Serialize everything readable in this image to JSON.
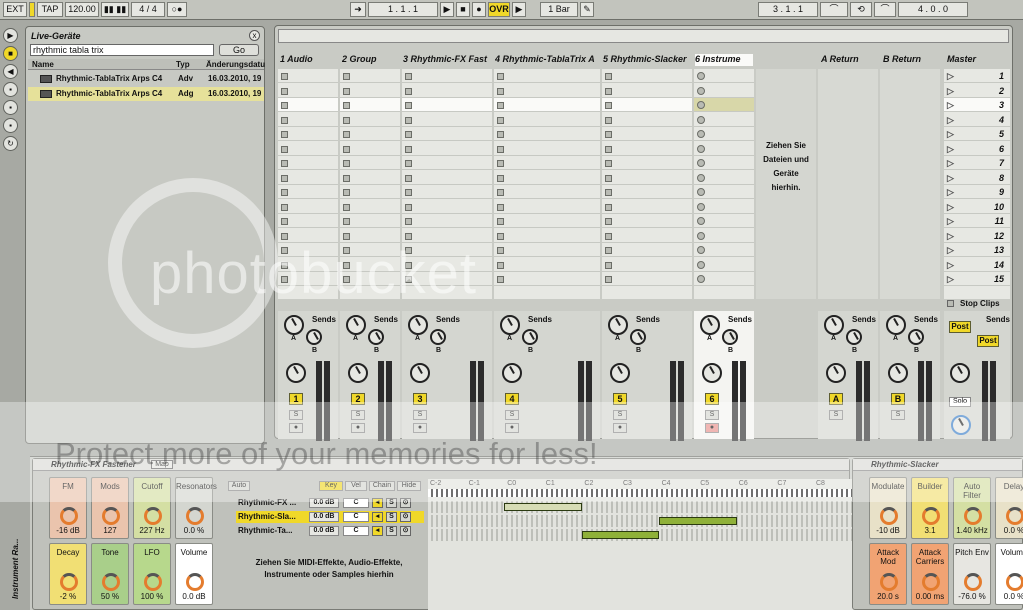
{
  "transport": {
    "ext": "EXT",
    "tap": "TAP",
    "tempo": "120.00",
    "signature": "4 / 4",
    "position": "1 .   1 .   1",
    "ovr": "OVR",
    "quantize": "1 Bar",
    "loop_start": "3 .   1 .   1",
    "loop_length": "4 .   0 .   0"
  },
  "browser": {
    "title": "Live-Geräte",
    "close": "x",
    "search": "rhythmic tabla trix",
    "go": "Go",
    "columns": [
      "Name",
      "Typ",
      "Änderungsdatu"
    ],
    "rows": [
      {
        "name": "Rhythmic-TablaTrix Arps C4",
        "type": "Adv",
        "date": "16.03.2010, 19:"
      },
      {
        "name": "Rhythmic-TablaTrix Arps C4",
        "type": "Adg",
        "date": "16.03.2010, 19:"
      }
    ]
  },
  "session": {
    "tracks": [
      "1 Audio",
      "2 Group",
      "3 Rhythmic-FX Fast",
      "4 Rhythmic-TablaTrix A",
      "5 Rhythmic-Slacker",
      "6 Instrume"
    ],
    "returns": [
      "A Return",
      "B Return"
    ],
    "master": "Master",
    "scenes": [
      "1",
      "2",
      "3",
      "4",
      "5",
      "6",
      "7",
      "8",
      "9",
      "10",
      "11",
      "12",
      "13",
      "14",
      "15"
    ],
    "drop_hint": "Ziehen Sie Dateien und Geräte hierhin.",
    "stop_clips": "Stop Clips",
    "sends_label": "Sends",
    "send_a": "A",
    "send_b": "B",
    "post": "Post",
    "solo": "Solo",
    "track_numbers": [
      "1",
      "2",
      "3",
      "4",
      "5",
      "6"
    ],
    "return_letters": [
      "A",
      "B"
    ],
    "s": "S"
  },
  "detail": {
    "device1": {
      "title": "Rhythmic-FX Fastener",
      "map": "Map",
      "macros_top": [
        {
          "label": "FM",
          "value": "-16 dB"
        },
        {
          "label": "Mods",
          "value": "127"
        },
        {
          "label": "Cutoff",
          "value": "227 Hz"
        },
        {
          "label": "Resonators",
          "value": "0.0 %"
        }
      ],
      "macros_bottom": [
        {
          "label": "Decay",
          "value": "-2 %"
        },
        {
          "label": "Tone",
          "value": "50 %"
        },
        {
          "label": "LFO",
          "value": "100 %"
        },
        {
          "label": "Volume",
          "value": "0.0 dB"
        }
      ],
      "auto": "Auto",
      "tabs": [
        "Key",
        "Vel",
        "Chain",
        "Hide"
      ],
      "chains": [
        {
          "name": "Rhythmic-FX ...",
          "vol": "0.0 dB",
          "key": "C"
        },
        {
          "name": "Rhythmic-Sla...",
          "vol": "0.0 dB",
          "key": "C"
        },
        {
          "name": "Rhythmic-Ta...",
          "vol": "0.0 dB",
          "key": "C"
        }
      ],
      "drop_hint": "Ziehen Sie MIDI-Effekte, Audio-Effekte, Instrumente oder Samples hierhin",
      "octaves": [
        "C-2",
        "C-1",
        "C0",
        "C1",
        "C2",
        "C3",
        "C4",
        "C5",
        "C6",
        "C7",
        "C8"
      ],
      "side_label": "Instrument Ra..."
    },
    "device2": {
      "title": "Rhythmic-Slacker",
      "macros_top": [
        {
          "label": "Modulate",
          "value": "-10 dB"
        },
        {
          "label": "Builder",
          "value": "3.1"
        },
        {
          "label": "Auto Filter",
          "value": "1.40 kHz"
        },
        {
          "label": "Delay",
          "value": "0.0 %"
        }
      ],
      "macros_bottom": [
        {
          "label": "Attack Mod",
          "value": "20.0 s"
        },
        {
          "label": "Attack Carriers",
          "value": "0.00 ms"
        },
        {
          "label": "Pitch Env",
          "value": "-76.0 %"
        },
        {
          "label": "Volume",
          "value": "0.0 %"
        }
      ]
    }
  },
  "watermark": {
    "logo": "photobucket",
    "banner": "Protect more of your memories for less!"
  }
}
